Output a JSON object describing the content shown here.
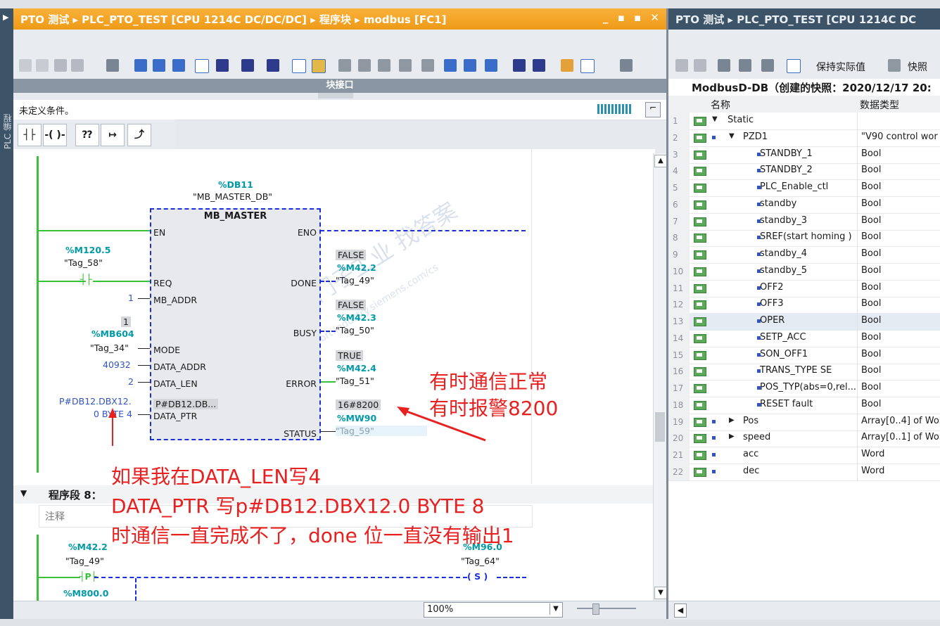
{
  "left_window": {
    "breadcrumb": "PTO 测试 ▸ PLC_PTO_TEST [CPU 1214C DC/DC/DC] ▸ 程序块 ▸ modbus [FC1]",
    "side_label": "PLC 编程",
    "controls": "_ ▪ ▪ ✕",
    "interface_bar": "块接口",
    "condition_text": "未定义条件。",
    "zoom": "100%"
  },
  "ladder": {
    "db_addr": "%DB11",
    "db_name": "\"MB_MASTER_DB\"",
    "block_name": "MB_MASTER",
    "pins_left": [
      "EN",
      "REQ",
      "MB_ADDR",
      "MODE",
      "DATA_ADDR",
      "DATA_LEN",
      "DATA_PTR"
    ],
    "pins_right": [
      "ENO",
      "DONE",
      "BUSY",
      "ERROR",
      "STATUS"
    ],
    "req_addr": "%M120.5",
    "req_tag": "\"Tag_58\"",
    "mb_addr_val": "1",
    "mode_val": "1",
    "mode_addr": "%MB604",
    "mode_tag": "\"Tag_34\"",
    "data_addr_val": "40932",
    "data_len_val": "2",
    "data_ptr_val1": "P#DB12.DBX12.",
    "data_ptr_val2": "0 BYTE 4",
    "data_ptr_inside": "P#DB12.DB...",
    "done_state": "FALSE",
    "done_addr": "%M42.2",
    "done_tag": "\"Tag_49\"",
    "busy_state": "FALSE",
    "busy_addr": "%M42.3",
    "busy_tag": "\"Tag_50\"",
    "error_state": "TRUE",
    "error_addr": "%M42.4",
    "error_tag": "\"Tag_51\"",
    "status_val": "16#8200",
    "status_addr": "%MW90",
    "status_tag": "\"Tag_59\"",
    "watermark1": "西门子工业  找答案",
    "watermark2": "support.industry.siemens.com/cs"
  },
  "section8": {
    "title": "程序段 8：",
    "comment": "注释",
    "in_addr": "%M42.2",
    "in_tag": "\"Tag_49\"",
    "p_contact": "P",
    "out_addr": "%M96.0",
    "out_tag": "\"Tag_64\"",
    "coil": "S",
    "bottom_addr": "%M800.0"
  },
  "annotations": {
    "line1": "有时通信正常",
    "line2": "有时报警8200",
    "q1": "如果我在DATA_LEN写4",
    "q2": "DATA_PTR 写p#DB12.DBX12.0 BYTE 8",
    "q3": "时通信一直完成不了，done 位一直没有输出1"
  },
  "right_window": {
    "breadcrumb": "PTO 测试 ▸ PLC_PTO_TEST [CPU 1214C DC",
    "keep_actual": "保持实际值",
    "snapshot": "快照",
    "snapshot_title": "ModbusD-DB（创建的快照：2020/12/17 20:",
    "col_name": "名称",
    "col_type": "数据类型",
    "rows": [
      {
        "n": "1",
        "name": "Static",
        "type": "",
        "lvl": 0,
        "tri": "▼",
        "sq": false
      },
      {
        "n": "2",
        "name": "PZD1",
        "type": "\"V90 control wor",
        "lvl": 1,
        "tri": "▼",
        "sq": true
      },
      {
        "n": "3",
        "name": "STANDBY_1",
        "type": "Bool",
        "lvl": 2,
        "tri": "",
        "sq": true
      },
      {
        "n": "4",
        "name": "STANDBY_2",
        "type": "Bool",
        "lvl": 2,
        "tri": "",
        "sq": true
      },
      {
        "n": "5",
        "name": "PLC_Enable_ctl",
        "type": "Bool",
        "lvl": 2,
        "tri": "",
        "sq": true
      },
      {
        "n": "6",
        "name": "standby",
        "type": "Bool",
        "lvl": 2,
        "tri": "",
        "sq": true
      },
      {
        "n": "7",
        "name": "standby_3",
        "type": "Bool",
        "lvl": 2,
        "tri": "",
        "sq": true
      },
      {
        "n": "8",
        "name": "SREF(start homing )",
        "type": "Bool",
        "lvl": 2,
        "tri": "",
        "sq": true
      },
      {
        "n": "9",
        "name": "standby_4",
        "type": "Bool",
        "lvl": 2,
        "tri": "",
        "sq": true
      },
      {
        "n": "10",
        "name": "standby_5",
        "type": "Bool",
        "lvl": 2,
        "tri": "",
        "sq": true
      },
      {
        "n": "11",
        "name": "OFF2",
        "type": "Bool",
        "lvl": 2,
        "tri": "",
        "sq": true
      },
      {
        "n": "12",
        "name": "OFF3",
        "type": "Bool",
        "lvl": 2,
        "tri": "",
        "sq": true
      },
      {
        "n": "13",
        "name": "OPER",
        "type": "Bool",
        "lvl": 2,
        "tri": "",
        "sq": true
      },
      {
        "n": "14",
        "name": "SETP_ACC",
        "type": "Bool",
        "lvl": 2,
        "tri": "",
        "sq": true
      },
      {
        "n": "15",
        "name": "SON_OFF1",
        "type": "Bool",
        "lvl": 2,
        "tri": "",
        "sq": true
      },
      {
        "n": "16",
        "name": "TRANS_TYPE SE",
        "type": "Bool",
        "lvl": 2,
        "tri": "",
        "sq": true
      },
      {
        "n": "17",
        "name": "POS_TYP(abs=0,rel...",
        "type": "Bool",
        "lvl": 2,
        "tri": "",
        "sq": true
      },
      {
        "n": "18",
        "name": "RESET fault",
        "type": "Bool",
        "lvl": 2,
        "tri": "",
        "sq": true
      },
      {
        "n": "19",
        "name": "Pos",
        "type": "Array[0..4] of Wor",
        "lvl": 1,
        "tri": "▶",
        "sq": true
      },
      {
        "n": "20",
        "name": "speed",
        "type": "Array[0..1] of Wor",
        "lvl": 1,
        "tri": "▶",
        "sq": true
      },
      {
        "n": "21",
        "name": "acc",
        "type": "Word",
        "lvl": 1,
        "tri": "",
        "sq": true
      },
      {
        "n": "22",
        "name": "dec",
        "type": "Word",
        "lvl": 1,
        "tri": "",
        "sq": true
      }
    ]
  },
  "colors": {
    "orange_title": "#f5a623",
    "teal": "#009aa6",
    "green_wire": "#3ac13a",
    "blue_dash": "#1a2fd6",
    "annotation_red": "#e82020"
  }
}
